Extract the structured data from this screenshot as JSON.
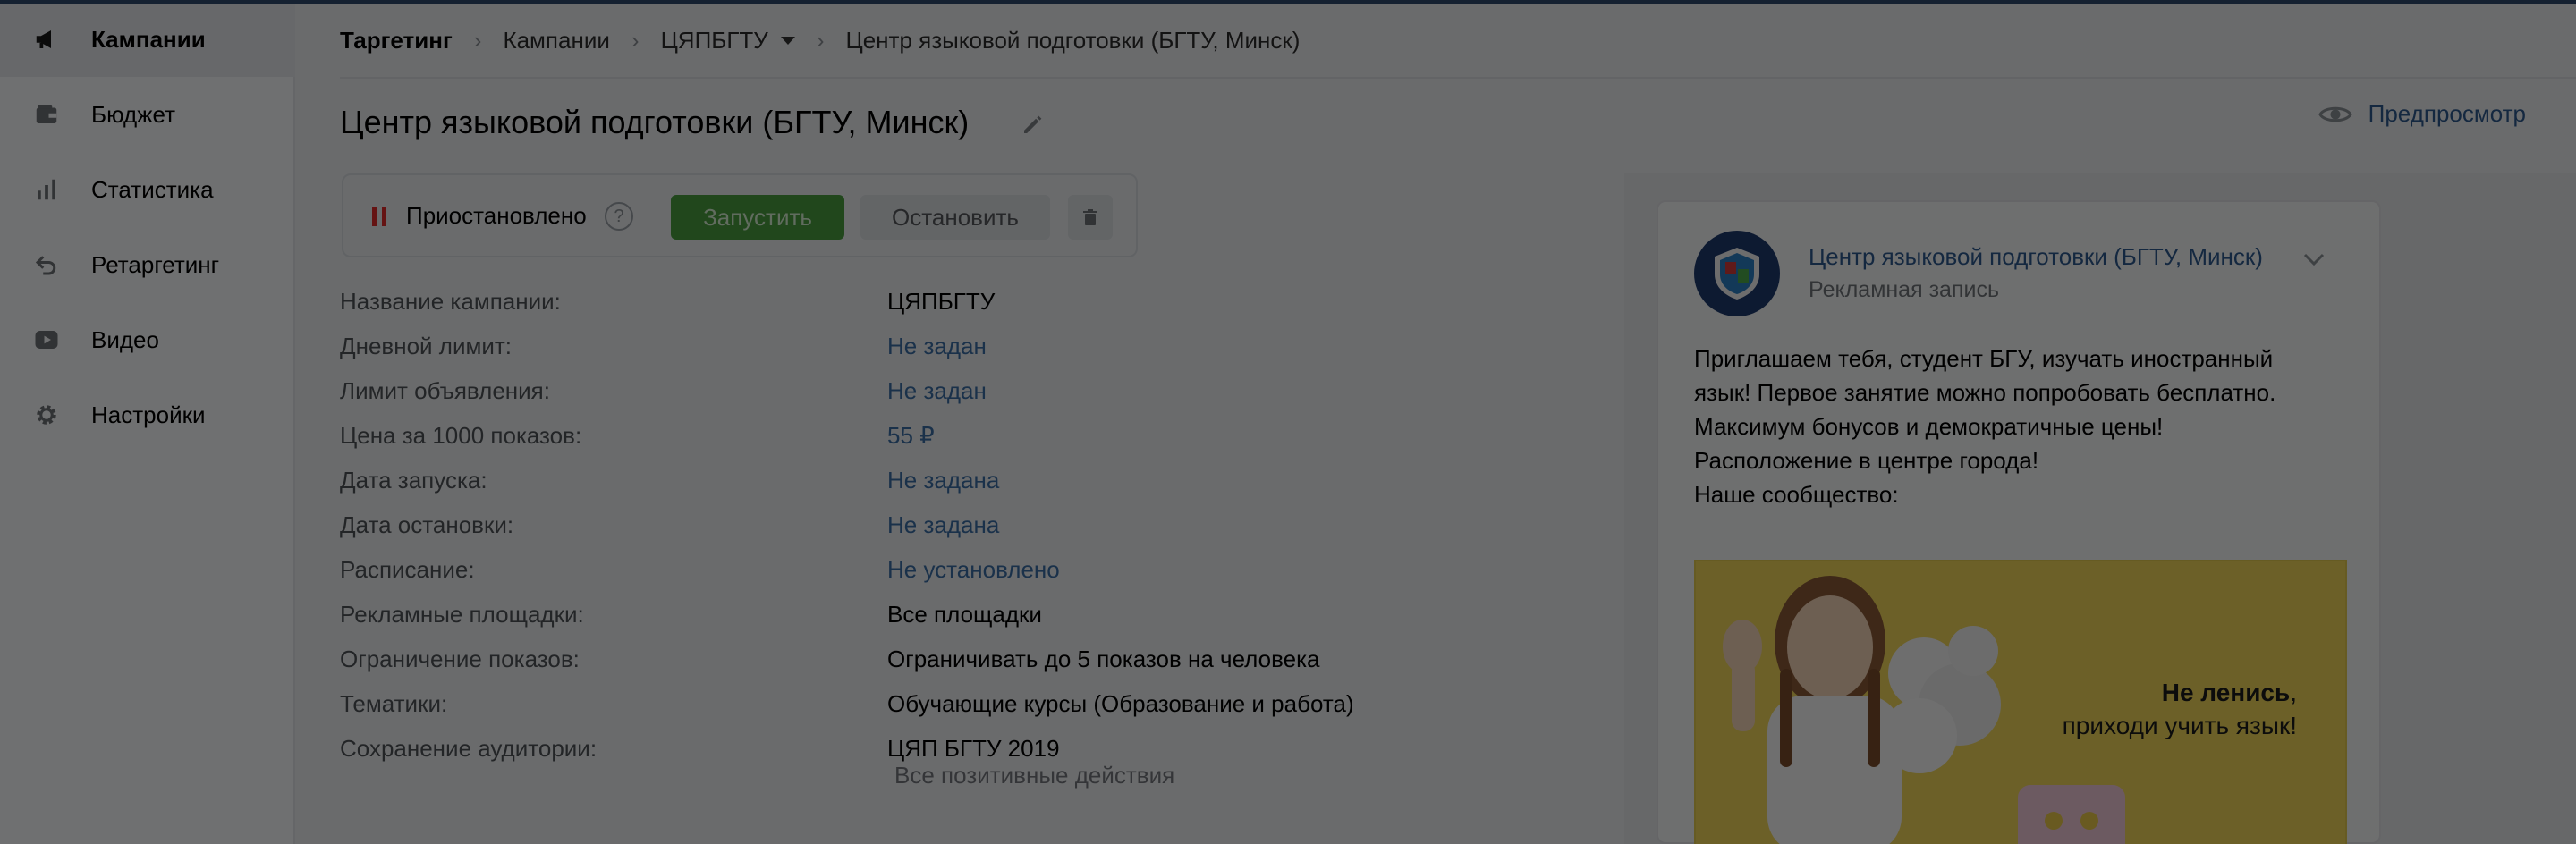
{
  "sidebar": {
    "items": [
      {
        "label": "Кампании",
        "icon": "megaphone-icon",
        "active": true
      },
      {
        "label": "Бюджет",
        "icon": "wallet-icon"
      },
      {
        "label": "Статистика",
        "icon": "bar-chart-icon"
      },
      {
        "label": "Ретаргетинг",
        "icon": "retarget-arrow-icon"
      },
      {
        "label": "Видео",
        "icon": "video-play-icon"
      },
      {
        "label": "Настройки",
        "icon": "gear-icon"
      }
    ]
  },
  "breadcrumb": {
    "items": [
      "Таргетинг",
      "Кампании",
      "ЦЯПБГТУ",
      "Центр языковой подготовки (БГТУ, Минск)"
    ]
  },
  "page": {
    "title": "Центр языковой подготовки (БГТУ, Минск)",
    "preview_label": "Предпросмотр"
  },
  "status": {
    "text": "Приостановлено",
    "help": "?",
    "launch_label": "Запустить",
    "stop_label": "Остановить"
  },
  "fields": [
    {
      "label": "Название кампании:",
      "value": "ЦЯПБГТУ",
      "link": false
    },
    {
      "label": "Дневной лимит:",
      "value": "Не задан",
      "link": true
    },
    {
      "label": "Лимит объявления:",
      "value": "Не задан",
      "link": true
    },
    {
      "label": "Цена за 1000 показов:",
      "value": "55 ₽",
      "link": true
    },
    {
      "label": "Дата запуска:",
      "value": "Не задана",
      "link": true
    },
    {
      "label": "Дата остановки:",
      "value": "Не задана",
      "link": true
    },
    {
      "label": "Расписание:",
      "value": "Не установлено",
      "link": true
    },
    {
      "label": "Рекламные площадки:",
      "value": "Все площадки",
      "link": false
    },
    {
      "label": "Ограничение показов:",
      "value": "Ограничивать до 5 показов на человека",
      "link": false
    },
    {
      "label": "Тематики:",
      "value": "Обучающие курсы (Образование и работа)",
      "link": false
    },
    {
      "label": "Сохранение аудитории:",
      "value": "ЦЯП БГТУ 2019",
      "link": false
    }
  ],
  "audience_sub": "Все позитивные действия",
  "ad": {
    "page_name": "Центр языковой подготовки (БГТУ, Минск)",
    "ad_label": "Рекламная запись",
    "text_lines": [
      "Приглашаем тебя, студент БГУ, изучать иностранный",
      "язык! Первое занятие можно попробовать бесплатно.",
      "Максимум бонусов и демократичные цены!",
      "Расположение в центре города!",
      "Наше сообщество:"
    ],
    "image_caption_bold": "Не ленись",
    "image_caption_comma": ",",
    "image_caption_line2": "приходи учить язык!"
  },
  "colors": {
    "accent": "#2e5a8e",
    "launch_button": "#4a9e3f",
    "paused_status": "#e02c2c",
    "dim_overlay": "rgba(0,0,0,0.55)"
  }
}
